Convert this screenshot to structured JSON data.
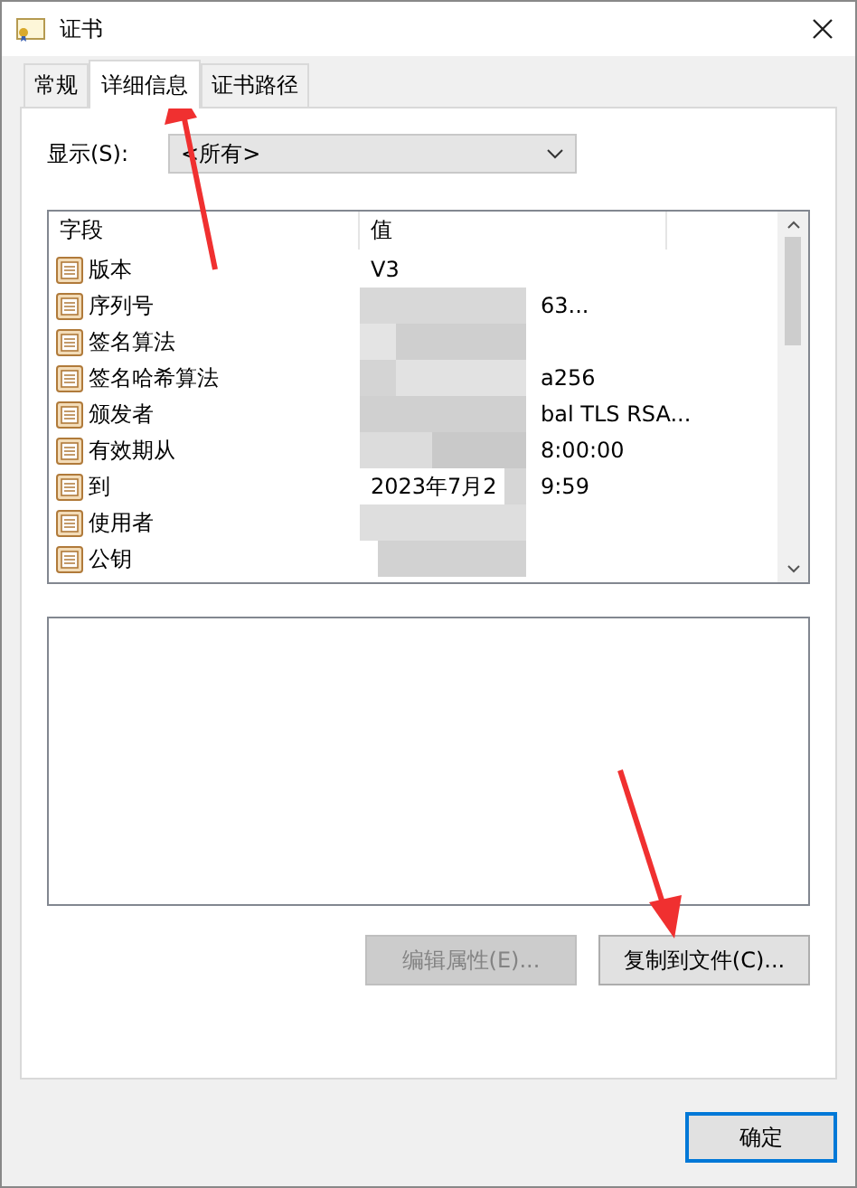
{
  "window": {
    "title": "证书"
  },
  "tabs": [
    {
      "label": "常规",
      "selected": false
    },
    {
      "label": "详细信息",
      "selected": true
    },
    {
      "label": "证书路径",
      "selected": false
    }
  ],
  "show": {
    "label": "显示(S):",
    "value": "<所有>"
  },
  "list": {
    "columns": [
      "字段",
      "值"
    ],
    "rows": [
      {
        "field": "版本",
        "value": "V3"
      },
      {
        "field": "序列号",
        "value_tail": "63..."
      },
      {
        "field": "签名算法"
      },
      {
        "field": "签名哈希算法",
        "value_tail": "a256"
      },
      {
        "field": "颁发者",
        "value_tail": "bal TLS RSA..."
      },
      {
        "field": "有效期从",
        "value_tail": "8:00:00"
      },
      {
        "field": "到",
        "value": "2023年7月2",
        "value_tail": "9:59"
      },
      {
        "field": "使用者"
      },
      {
        "field": "公钥"
      }
    ]
  },
  "buttons": [
    {
      "label": "编辑属性(E)...",
      "disabled": true
    },
    {
      "label": "复制到文件(C)...",
      "disabled": false
    }
  ],
  "ok_button": "确定"
}
